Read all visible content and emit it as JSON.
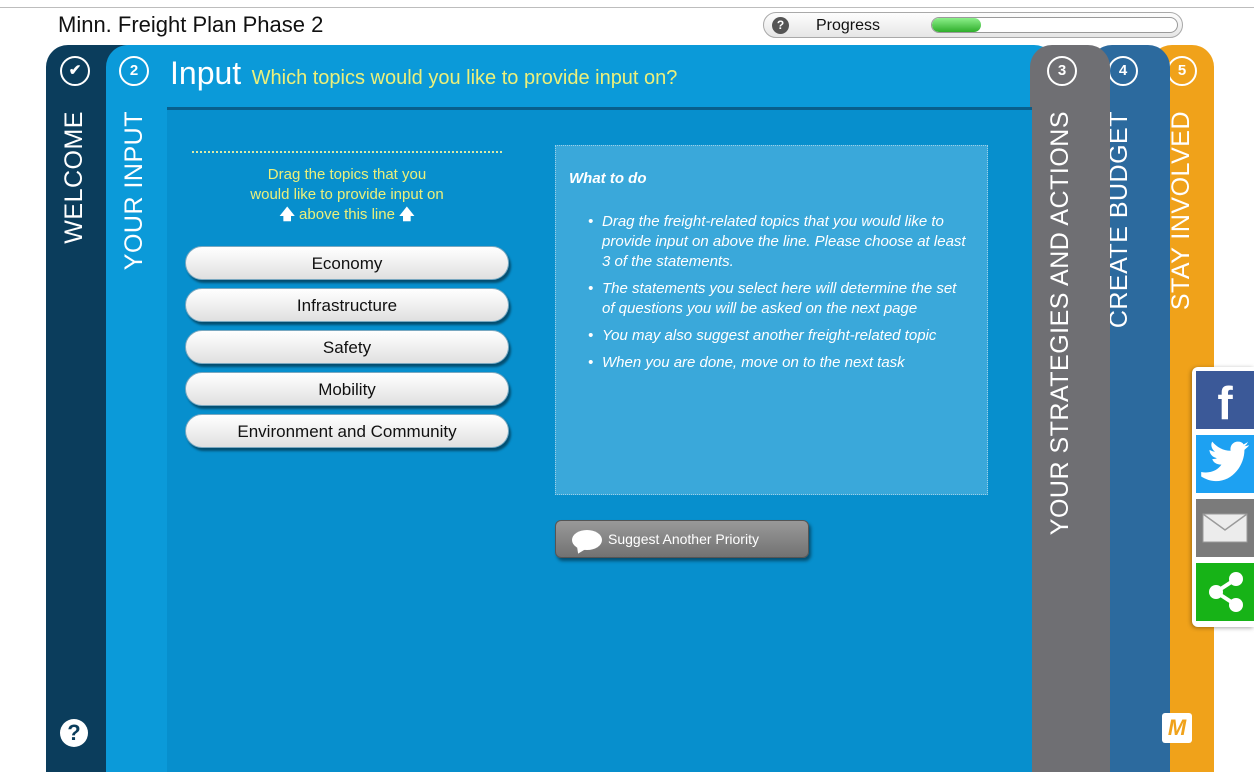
{
  "app": {
    "title": "Minn. Freight Plan Phase 2"
  },
  "progress": {
    "label": "Progress",
    "help_glyph": "?",
    "value": 0.2
  },
  "tabs": [
    {
      "number": "✔",
      "title": "WELCOME"
    },
    {
      "number": "2",
      "title": "YOUR INPUT"
    },
    {
      "number": "3",
      "title": "YOUR STRATEGIES AND ACTIONS"
    },
    {
      "number": "4",
      "title": "CREATE BUDGET"
    },
    {
      "number": "5",
      "title": "STAY INVOLVED"
    }
  ],
  "help": {
    "glyph": "?"
  },
  "input": {
    "heading": "Input",
    "subheading": "Which topics would you like to provide input on?",
    "drag_line1": "Drag the topics that you",
    "drag_line2": "would like to provide input on",
    "drag_line3": "above this line",
    "topics": [
      "Economy",
      "Infrastructure",
      "Safety",
      "Mobility",
      "Environment and Community"
    ],
    "what_to_do_title": "What to do",
    "instructions": [
      "Drag the freight-related topics that you would like to provide input on above the line. Please choose at least 3 of the statements.",
      "The statements you select here will determine the set of questions you will be asked on the next page",
      "You may also suggest another freight-related topic",
      "When you are done, move on to the next task"
    ],
    "suggest_button": "Suggest Another Priority"
  },
  "social": {
    "items": [
      {
        "name": "facebook",
        "glyph": "f"
      },
      {
        "name": "twitter",
        "glyph": ""
      },
      {
        "name": "email",
        "glyph": ""
      },
      {
        "name": "share",
        "glyph": ""
      }
    ]
  },
  "logo": {
    "glyph": "M"
  },
  "colors": {
    "welcome": "#0b3d5c",
    "input": "#0b9ad9",
    "content": "#078fcd",
    "strategies": "#6f6f73",
    "budget": "#2c6a9e",
    "stay": "#f0a21a",
    "heading_accent": "#ecf07a"
  }
}
